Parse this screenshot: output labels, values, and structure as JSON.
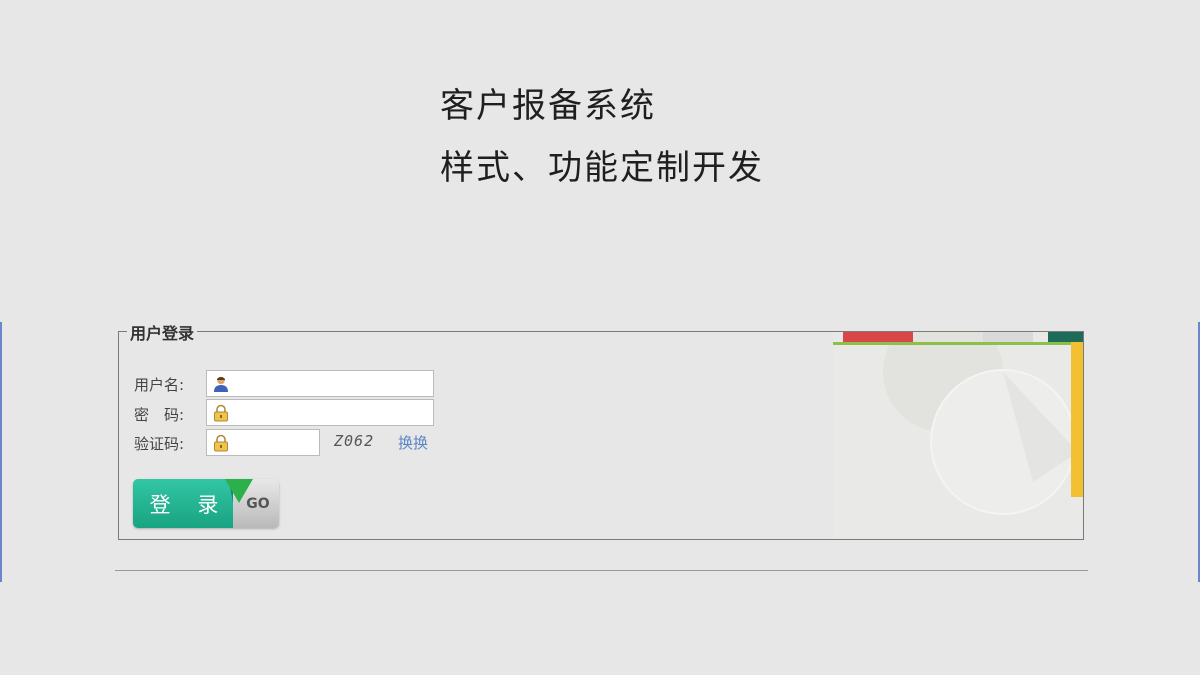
{
  "header": {
    "title_line1": "客户报备系统",
    "title_line2": "样式、功能定制开发"
  },
  "login": {
    "legend": "用户登录",
    "username_label": "用户名:",
    "password_label": "密　码:",
    "captcha_label": "验证码:",
    "username_value": "",
    "password_value": "",
    "captcha_value": "",
    "captcha_code": "Z062",
    "refresh_label": "换换",
    "submit_label": "登 录",
    "go_label": "GO"
  },
  "icons": {
    "user": "user-icon",
    "lock": "lock-icon"
  },
  "colors": {
    "background": "#e7e7e7",
    "button_green": "#19a381",
    "link": "#5a86c8",
    "side_line": "#6b86c6"
  }
}
